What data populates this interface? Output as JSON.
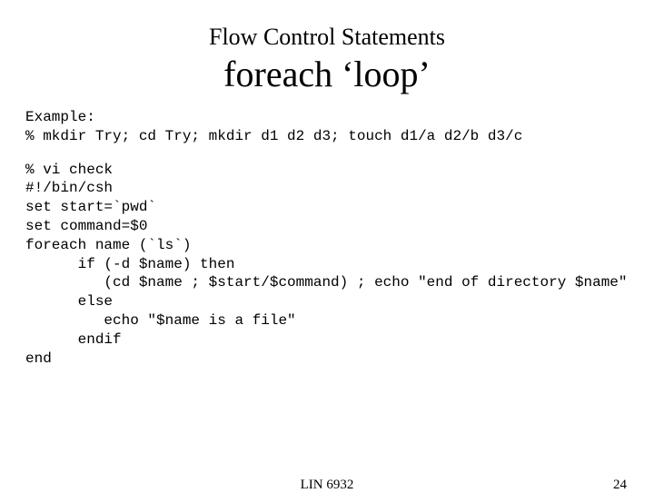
{
  "title1": "Flow Control Statements",
  "title2": "foreach ‘loop’",
  "part1": "Example:\n% mkdir Try; cd Try; mkdir d1 d2 d3; touch d1/a d2/b d3/c",
  "part2": "% vi check\n#!/bin/csh\nset start=`pwd`\nset command=$0\nforeach name (`ls`)\n      if (-d $name) then\n         (cd $name ; $start/$command) ; echo \"end of directory $name\"\n      else\n         echo \"$name is a file\"\n      endif\nend",
  "footer_center": "LIN 6932",
  "footer_right": "24"
}
